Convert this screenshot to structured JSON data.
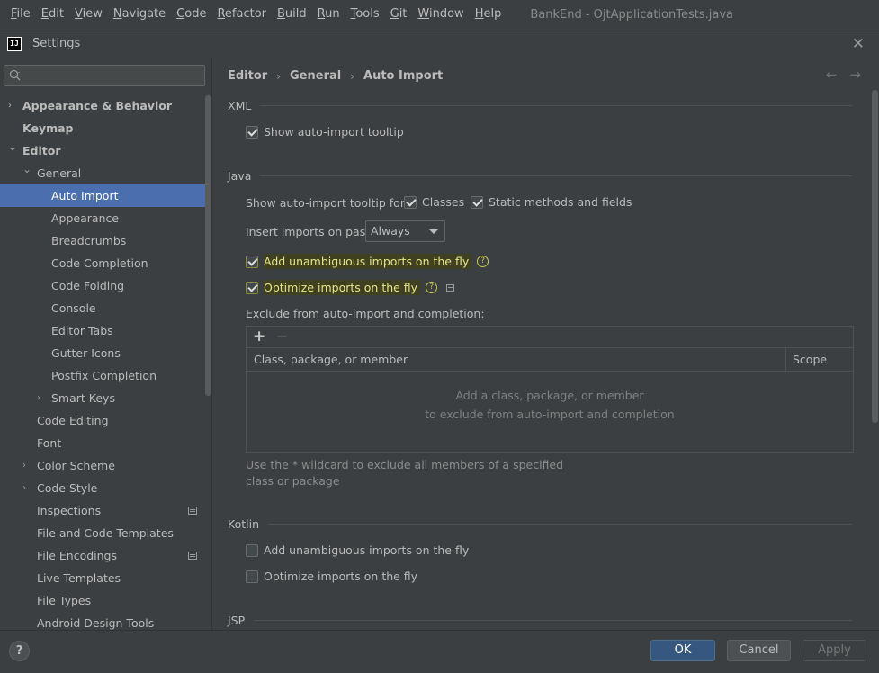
{
  "menubar": {
    "items": [
      {
        "u": "F",
        "rest": "ile"
      },
      {
        "u": "E",
        "rest": "dit"
      },
      {
        "u": "V",
        "rest": "iew"
      },
      {
        "u": "N",
        "rest": "avigate"
      },
      {
        "u": "C",
        "rest": "ode"
      },
      {
        "u": "R",
        "rest": "efactor"
      },
      {
        "u": "B",
        "rest": "uild"
      },
      {
        "u": "R",
        "rest": "un"
      },
      {
        "u": "T",
        "rest": "ools"
      },
      {
        "u": "G",
        "rest": "it"
      },
      {
        "u": "W",
        "rest": "indow"
      },
      {
        "u": "H",
        "rest": "elp"
      }
    ],
    "window_title": "BankEnd - OjtApplicationTests.java"
  },
  "dialog": {
    "logo_text": "IJ",
    "title": "Settings",
    "close_glyph": "✕"
  },
  "sidebar": {
    "search_placeholder": "",
    "items": [
      {
        "label": "Appearance & Behavior",
        "level": 0,
        "arrow": "›",
        "bold": true
      },
      {
        "label": "Keymap",
        "level": 0,
        "arrow": "",
        "bold": true
      },
      {
        "label": "Editor",
        "level": 0,
        "arrow": "⌄",
        "bold": true
      },
      {
        "label": "General",
        "level": 1,
        "arrow": "⌄"
      },
      {
        "label": "Auto Import",
        "level": 2,
        "arrow": "",
        "selected": true
      },
      {
        "label": "Appearance",
        "level": 2,
        "arrow": ""
      },
      {
        "label": "Breadcrumbs",
        "level": 2,
        "arrow": ""
      },
      {
        "label": "Code Completion",
        "level": 2,
        "arrow": ""
      },
      {
        "label": "Code Folding",
        "level": 2,
        "arrow": ""
      },
      {
        "label": "Console",
        "level": 2,
        "arrow": ""
      },
      {
        "label": "Editor Tabs",
        "level": 2,
        "arrow": ""
      },
      {
        "label": "Gutter Icons",
        "level": 2,
        "arrow": ""
      },
      {
        "label": "Postfix Completion",
        "level": 2,
        "arrow": ""
      },
      {
        "label": "Smart Keys",
        "level": 2,
        "arrow": "›"
      },
      {
        "label": "Code Editing",
        "level": 1,
        "arrow": ""
      },
      {
        "label": "Font",
        "level": 1,
        "arrow": ""
      },
      {
        "label": "Color Scheme",
        "level": 1,
        "arrow": "›"
      },
      {
        "label": "Code Style",
        "level": 1,
        "arrow": "›"
      },
      {
        "label": "Inspections",
        "level": 1,
        "arrow": "",
        "cfg": true
      },
      {
        "label": "File and Code Templates",
        "level": 1,
        "arrow": ""
      },
      {
        "label": "File Encodings",
        "level": 1,
        "arrow": "",
        "cfg": true
      },
      {
        "label": "Live Templates",
        "level": 1,
        "arrow": ""
      },
      {
        "label": "File Types",
        "level": 1,
        "arrow": ""
      },
      {
        "label": "Android Design Tools",
        "level": 1,
        "arrow": ""
      }
    ]
  },
  "breadcrumb": {
    "items": [
      "Editor",
      "General",
      "Auto Import"
    ],
    "separator": "›",
    "back_glyph": "←",
    "forward_glyph": "→"
  },
  "xml": {
    "title": "XML",
    "show_tooltip": {
      "label": "Show auto-import tooltip",
      "checked": true
    }
  },
  "java": {
    "title": "Java",
    "tooltip_for_label": "Show auto-import tooltip for:",
    "classes": {
      "label": "Classes",
      "checked": true
    },
    "static_methods": {
      "label": "Static methods and fields",
      "checked": true
    },
    "insert_on_paste_label": "Insert imports on paste:",
    "insert_on_paste_value": "Always",
    "add_unambiguous": {
      "label": "Add unambiguous imports on the fly",
      "checked": true
    },
    "optimize": {
      "label": "Optimize imports on the fly",
      "checked": true
    },
    "help_glyph": "?",
    "exclude_label": "Exclude from auto-import and completion:",
    "table": {
      "add_glyph": "+",
      "remove_glyph": "−",
      "columns": [
        "Class, package, or member",
        "Scope"
      ],
      "empty_line1": "Add a class, package, or member",
      "empty_line2": "to exclude from auto-import and completion"
    },
    "hint": "Use the * wildcard to exclude all members of a specified class or package"
  },
  "kotlin": {
    "title": "Kotlin",
    "add_unambiguous": {
      "label": "Add unambiguous imports on the fly",
      "checked": false
    },
    "optimize": {
      "label": "Optimize imports on the fly",
      "checked": false
    }
  },
  "jsp": {
    "title": "JSP"
  },
  "footer": {
    "help_glyph": "?",
    "ok": "OK",
    "cancel": "Cancel",
    "apply": "Apply"
  },
  "colors": {
    "selection": "#4b6eaf",
    "ok_button": "#365880",
    "highlight_bg": "#3f4120",
    "highlight_text": "#e5e58a"
  }
}
